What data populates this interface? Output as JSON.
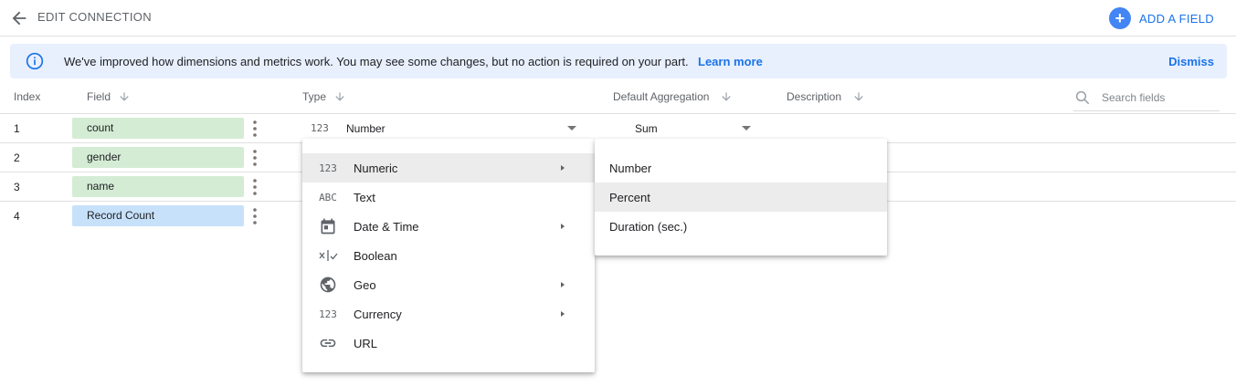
{
  "header": {
    "title": "EDIT CONNECTION",
    "add_field_label": "ADD A FIELD"
  },
  "banner": {
    "message": "We've improved how dimensions and metrics work. You may see some changes, but no action is required on your part.",
    "learn_more": "Learn more",
    "dismiss": "Dismiss"
  },
  "columns": {
    "index": "Index",
    "field": "Field",
    "type": "Type",
    "aggregation": "Default Aggregation",
    "description": "Description"
  },
  "search": {
    "placeholder": "Search fields"
  },
  "rows": [
    {
      "index": "1",
      "field": "count",
      "kind": "dimension"
    },
    {
      "index": "2",
      "field": "gender",
      "kind": "dimension"
    },
    {
      "index": "3",
      "field": "name",
      "kind": "dimension"
    },
    {
      "index": "4",
      "field": "Record Count",
      "kind": "metric"
    }
  ],
  "row1_type": {
    "glyph": "123",
    "value": "Number"
  },
  "row1_aggregation": {
    "value": "Sum"
  },
  "type_menu": {
    "items": [
      {
        "icon": "numeric-icon",
        "glyph": "123",
        "label": "Numeric",
        "submenu": true
      },
      {
        "icon": "text-icon",
        "glyph": "ABC",
        "label": "Text",
        "submenu": false
      },
      {
        "icon": "calendar-icon",
        "glyph": "",
        "label": "Date & Time",
        "submenu": true
      },
      {
        "icon": "boolean-icon",
        "glyph": "",
        "label": "Boolean",
        "submenu": false
      },
      {
        "icon": "globe-icon",
        "glyph": "",
        "label": "Geo",
        "submenu": true
      },
      {
        "icon": "currency-icon",
        "glyph": "123",
        "label": "Currency",
        "submenu": true
      },
      {
        "icon": "link-icon",
        "glyph": "",
        "label": "URL",
        "submenu": false
      }
    ]
  },
  "sub_menu": {
    "items": [
      {
        "label": "Number"
      },
      {
        "label": "Percent"
      },
      {
        "label": "Duration (sec.)"
      }
    ]
  },
  "colors": {
    "accent": "#1a73e8",
    "dimension_chip": "#d4ecd4",
    "metric_chip": "#c7e1fb",
    "banner_bg": "#e8f0fe",
    "menu_highlight": "#ececec"
  }
}
